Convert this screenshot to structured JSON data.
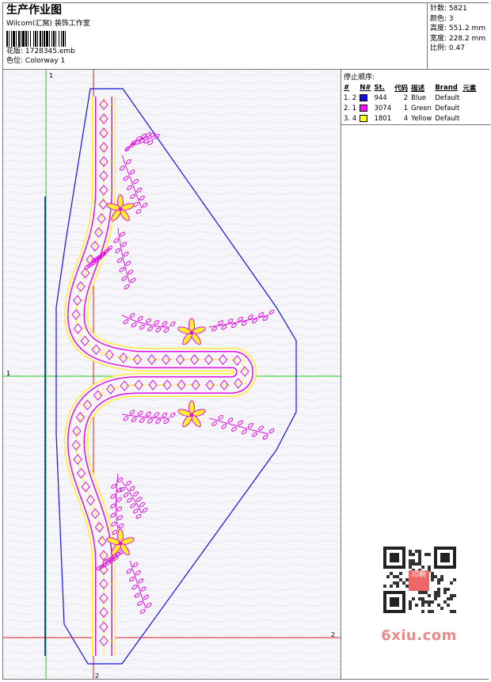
{
  "header": {
    "title": "生产作业图",
    "company": "Wilcom(汇窝) 装饰工作室",
    "design_file_label": "花版:",
    "design_file": "1728345.emb",
    "colorway_label": "色位:",
    "colorway": "Colorway 1"
  },
  "stats": {
    "stitches_label": "针数:",
    "stitches": "5821",
    "colors_label": "颜色:",
    "colors": "3",
    "height_label": "高度:",
    "height": "551.2 mm",
    "width_label": "宽度:",
    "width": "228.2 mm",
    "scale_label": "比例:",
    "scale": "0.47"
  },
  "stop_sequence": {
    "title": "停止顺序:",
    "columns": [
      "#",
      "N#",
      "St.",
      "代码",
      "描述",
      "Brand",
      "元素"
    ],
    "rows": [
      {
        "num": "1. 2",
        "st": "944",
        "code": "2",
        "desc": "Blue",
        "brand": "Default",
        "color": "#1010e0"
      },
      {
        "num": "2. 1",
        "st": "3074",
        "code": "1",
        "desc": "Green",
        "brand": "Default",
        "color": "#ff10ff"
      },
      {
        "num": "3. 4",
        "st": "1801",
        "code": "4",
        "desc": "Yellow",
        "brand": "Default",
        "color": "#ffff20"
      }
    ]
  },
  "guides": {
    "v1": "1",
    "h1": "1",
    "h2": "2",
    "v2": "2"
  },
  "watermark": {
    "text": "6xiu.com",
    "seal": "印刷"
  },
  "colors": {
    "blue": "#1010e0",
    "magenta": "#e010e0",
    "yellow": "#ffee30",
    "green": "#20d020",
    "red": "#e02020"
  }
}
